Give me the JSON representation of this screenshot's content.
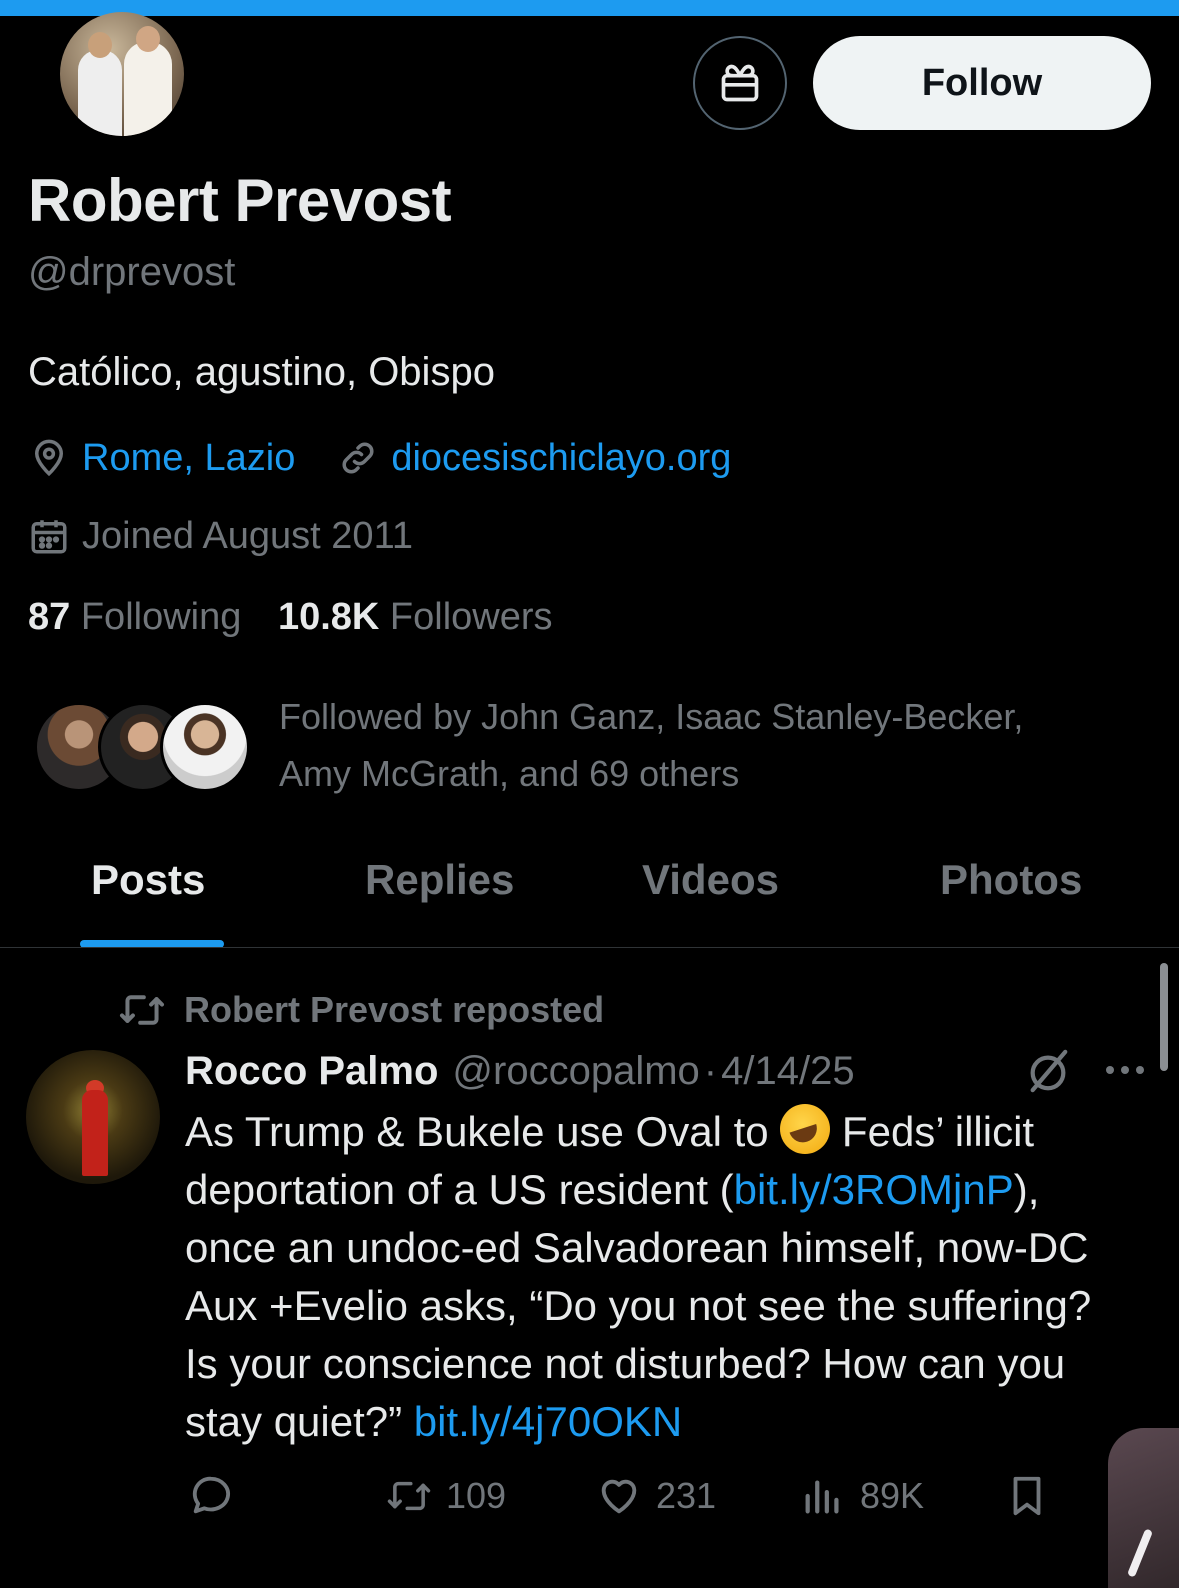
{
  "profile": {
    "name": "Robert Prevost",
    "handle": "@drprevost",
    "bio": "Católico, agustino, Obispo",
    "location": "Rome, Lazio",
    "website": "diocesischiclayo.org",
    "joined": "Joined August 2011",
    "following_count": "87",
    "following_label": "Following",
    "followers_count": "10.8K",
    "followers_label": "Followers",
    "followed_by_line1": "Followed by John Ganz, Isaac Stanley-Becker,",
    "followed_by_line2": "Amy McGrath, and 69 others"
  },
  "header": {
    "follow_label": "Follow"
  },
  "tabs": [
    {
      "label": "Posts",
      "active": true
    },
    {
      "label": "Replies",
      "active": false
    },
    {
      "label": "Videos",
      "active": false
    },
    {
      "label": "Photos",
      "active": false
    }
  ],
  "post": {
    "repost_label": "Robert Prevost reposted",
    "author_name": "Rocco Palmo",
    "author_handle": "@roccopalmo",
    "separator": "·",
    "date": "4/14/25",
    "text_part1": "As Trump & Bukele use Oval to ",
    "text_part2": " Feds’ illicit deportation of a US resident (",
    "link1": "bit.ly/3ROMjnP",
    "text_part3": "), once an undoc-ed Salvadorean himself, now-DC Aux +Evelio asks, “Do you not see the suffering? Is your conscience not disturbed? How can you stay quiet?” ",
    "link2": "bit.ly/4j70OKN",
    "reposts": "109",
    "likes": "231",
    "views": "89K"
  },
  "icons": {
    "gift": "gift-icon",
    "location": "location-pin-icon",
    "link": "link-icon",
    "calendar": "calendar-icon",
    "repost": "repost-icon",
    "grok": "grok-icon",
    "more": "more-icon",
    "reply": "reply-icon",
    "like": "heart-icon",
    "views": "views-icon",
    "bookmark": "bookmark-icon"
  },
  "colors": {
    "accent": "#1d9bf0",
    "background": "#000000",
    "text_primary": "#e7e9ea",
    "text_secondary": "#71767b",
    "follow_button_bg": "#eff3f4"
  }
}
